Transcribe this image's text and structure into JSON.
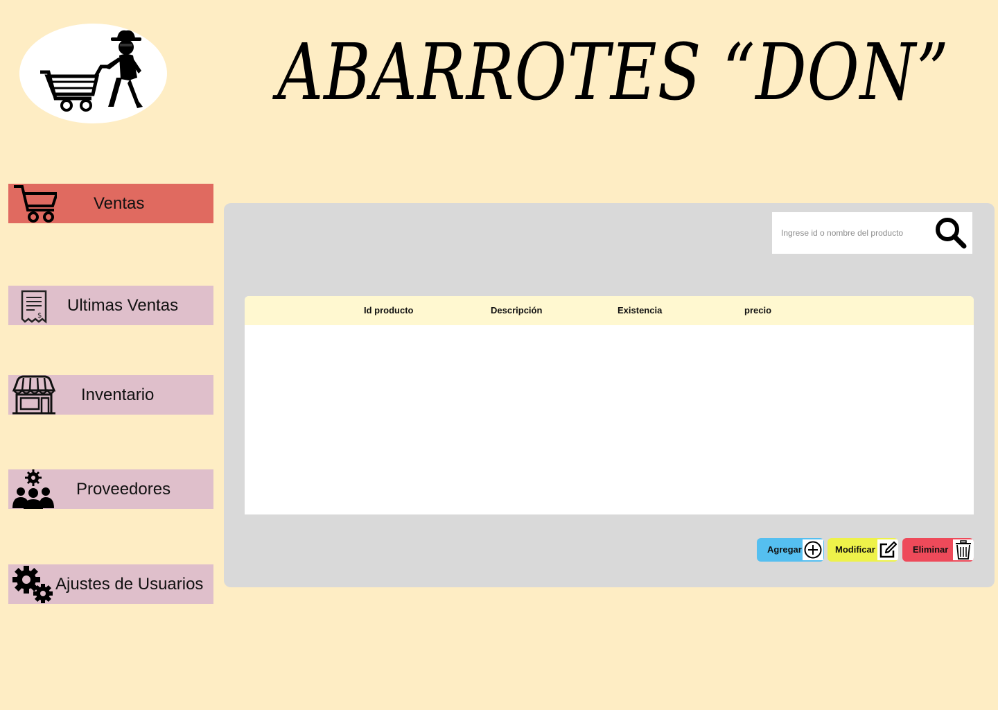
{
  "header": {
    "title": "ABARROTES “DON”",
    "logo_icon": "shopper-with-cart-icon"
  },
  "sidebar": {
    "items": [
      {
        "label": "Ventas",
        "icon": "shopping-cart-icon",
        "active": true
      },
      {
        "label": "Ultimas Ventas",
        "icon": "receipt-icon",
        "active": false
      },
      {
        "label": "Inventario",
        "icon": "store-icon",
        "active": false
      },
      {
        "label": "Proveedores",
        "icon": "team-gear-icon",
        "active": false
      },
      {
        "label": "Ajustes de Usuarios",
        "icon": "gears-icon",
        "active": false
      }
    ]
  },
  "search": {
    "placeholder": "Ingrese id o nombre del producto",
    "value": "",
    "icon": "search-icon"
  },
  "table": {
    "columns": [
      "Id producto",
      "Descripción",
      "Existencia",
      "precio"
    ],
    "rows": []
  },
  "actions": {
    "add_label": "Agregar",
    "modify_label": "Modificar",
    "delete_label": "Eliminar"
  },
  "colors": {
    "background": "#feedc4",
    "active_nav": "#e06a60",
    "nav": "#dfbfcb",
    "panel": "#d9d9d9",
    "table_header": "#fff8d0",
    "add": "#55bff0",
    "modify": "#eef24a",
    "delete": "#ee4a5a"
  }
}
